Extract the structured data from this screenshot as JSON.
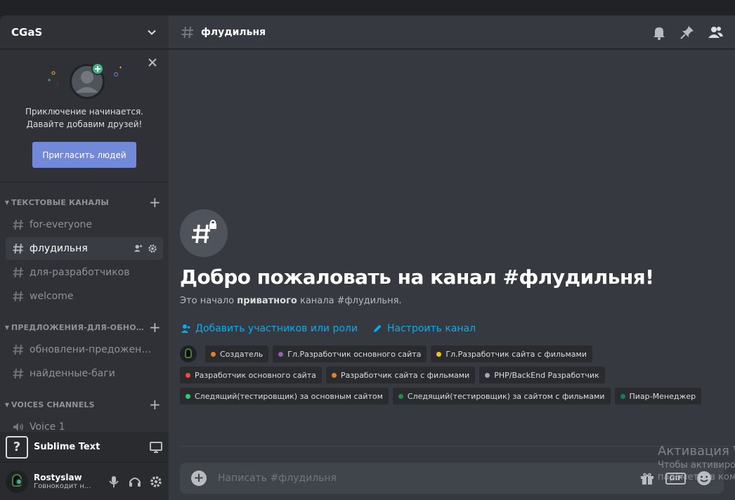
{
  "server": {
    "name": "CGaS"
  },
  "invite": {
    "line1": "Приключение начинается.",
    "line2": "Давайте добавим друзей!",
    "button_label": "Пригласить людей"
  },
  "categories": [
    {
      "label": "ТЕКСТОВЫЕ КАНАЛЫ"
    },
    {
      "label": "ПРЕДЛОЖЕНИЯ-ДЛЯ-ОБНОВЛЕ..."
    },
    {
      "label": "VOICES CHANNELS"
    }
  ],
  "text_channels": [
    {
      "name": "for-everyone"
    },
    {
      "name": "флудильня"
    },
    {
      "name": "для-разработчиков"
    },
    {
      "name": "welcome"
    }
  ],
  "suggest_channels": [
    {
      "name": "обновлени-предожения..."
    },
    {
      "name": "найденные-баги"
    }
  ],
  "voice_channels": [
    {
      "name": "Voice 1"
    }
  ],
  "activity": {
    "icon_text": "?",
    "name": "Sublime Text"
  },
  "user": {
    "name": "Rostyslaw",
    "status": "Говнокодит н..."
  },
  "channel": {
    "title": "флудильня",
    "welcome_title": "Добро пожаловать на канал #флудильня!",
    "intro_pre": "Это начало ",
    "intro_bold": "приватного",
    "intro_post": " канала #флудильня.",
    "add_members": "Добавить участников или роли",
    "configure": "Настроить канал"
  },
  "roles": [
    {
      "name": "Создатель",
      "color": "#e67e22"
    },
    {
      "name": "Гл.Разработчик основного сайта",
      "color": "#9b59b6"
    },
    {
      "name": "Гл.Разработчик сайта с фильмами",
      "color": "#f1c40f"
    },
    {
      "name": "Разработчик основного сайта",
      "color": "#e74c3c"
    },
    {
      "name": "Разработчик сайта с фильмами",
      "color": "#e67e22"
    },
    {
      "name": "PHP/BackEnd Разработчик",
      "color": "#99aab5"
    },
    {
      "name": "Следящий(тестировщик) за основным сайтом",
      "color": "#2ecc71"
    },
    {
      "name": "Следящий(тестировщик) за сайтом с фильмами",
      "color": "#1f8b4c"
    },
    {
      "name": "Пиар-Менеджер",
      "color": "#11806a"
    }
  ],
  "composer": {
    "placeholder": "Написать #флудильня",
    "gif_label": "GIF"
  },
  "watermark": {
    "line1": "Активация W",
    "line2": "Чтобы активиро",
    "line3": "параметров ком"
  }
}
